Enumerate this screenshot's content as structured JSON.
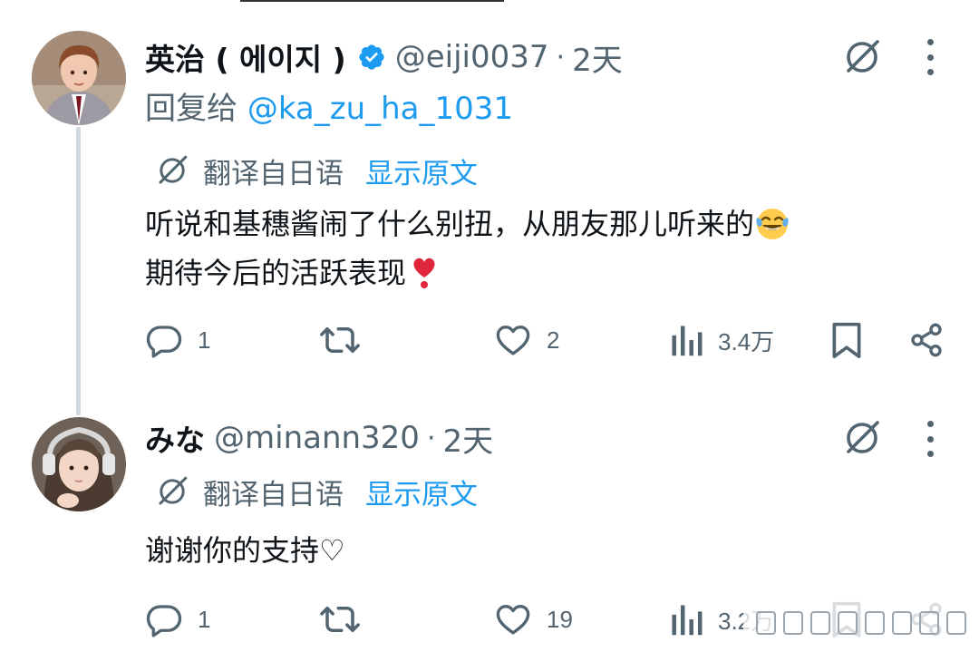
{
  "tweets": [
    {
      "display_name": "英治 ( 에이지 )",
      "handle": "@eiji0037",
      "separator": "·",
      "time": "2天",
      "reply_prefix": "回复给 ",
      "reply_mention": "@ka_zu_ha_1031",
      "translate_label": "翻译自日语",
      "show_original": "显示原文",
      "text_line1": "听说和基穗酱闹了什么别扭，从朋友那儿听来的",
      "text_line2": "期待今后的活跃表现",
      "emoji_line1": "face-with-tears-of-joy-emoji",
      "emoji_line2": "red-heart-exclamation-emoji",
      "verified": true,
      "replies": "1",
      "retweets": "",
      "likes": "2",
      "views": "3.4万"
    },
    {
      "display_name": "みな",
      "handle": "@minann320",
      "separator": "·",
      "time": "2天",
      "translate_label": "翻译自日语",
      "show_original": "显示原文",
      "text_line1": "谢谢你的支持♡",
      "verified": false,
      "replies": "1",
      "retweets": "",
      "likes": "19",
      "views": "3.2万"
    }
  ],
  "colors": {
    "text_primary": "#0f1419",
    "text_secondary": "#536471",
    "accent_blue": "#1d9bf0",
    "thread_line": "#cfd9de",
    "heart_red": "#e0263b"
  },
  "icons": [
    "grok-icon",
    "more-icon",
    "verified-badge-icon",
    "reply-icon",
    "retweet-icon",
    "like-icon",
    "views-icon",
    "bookmark-icon",
    "share-icon",
    "translate-icon"
  ]
}
